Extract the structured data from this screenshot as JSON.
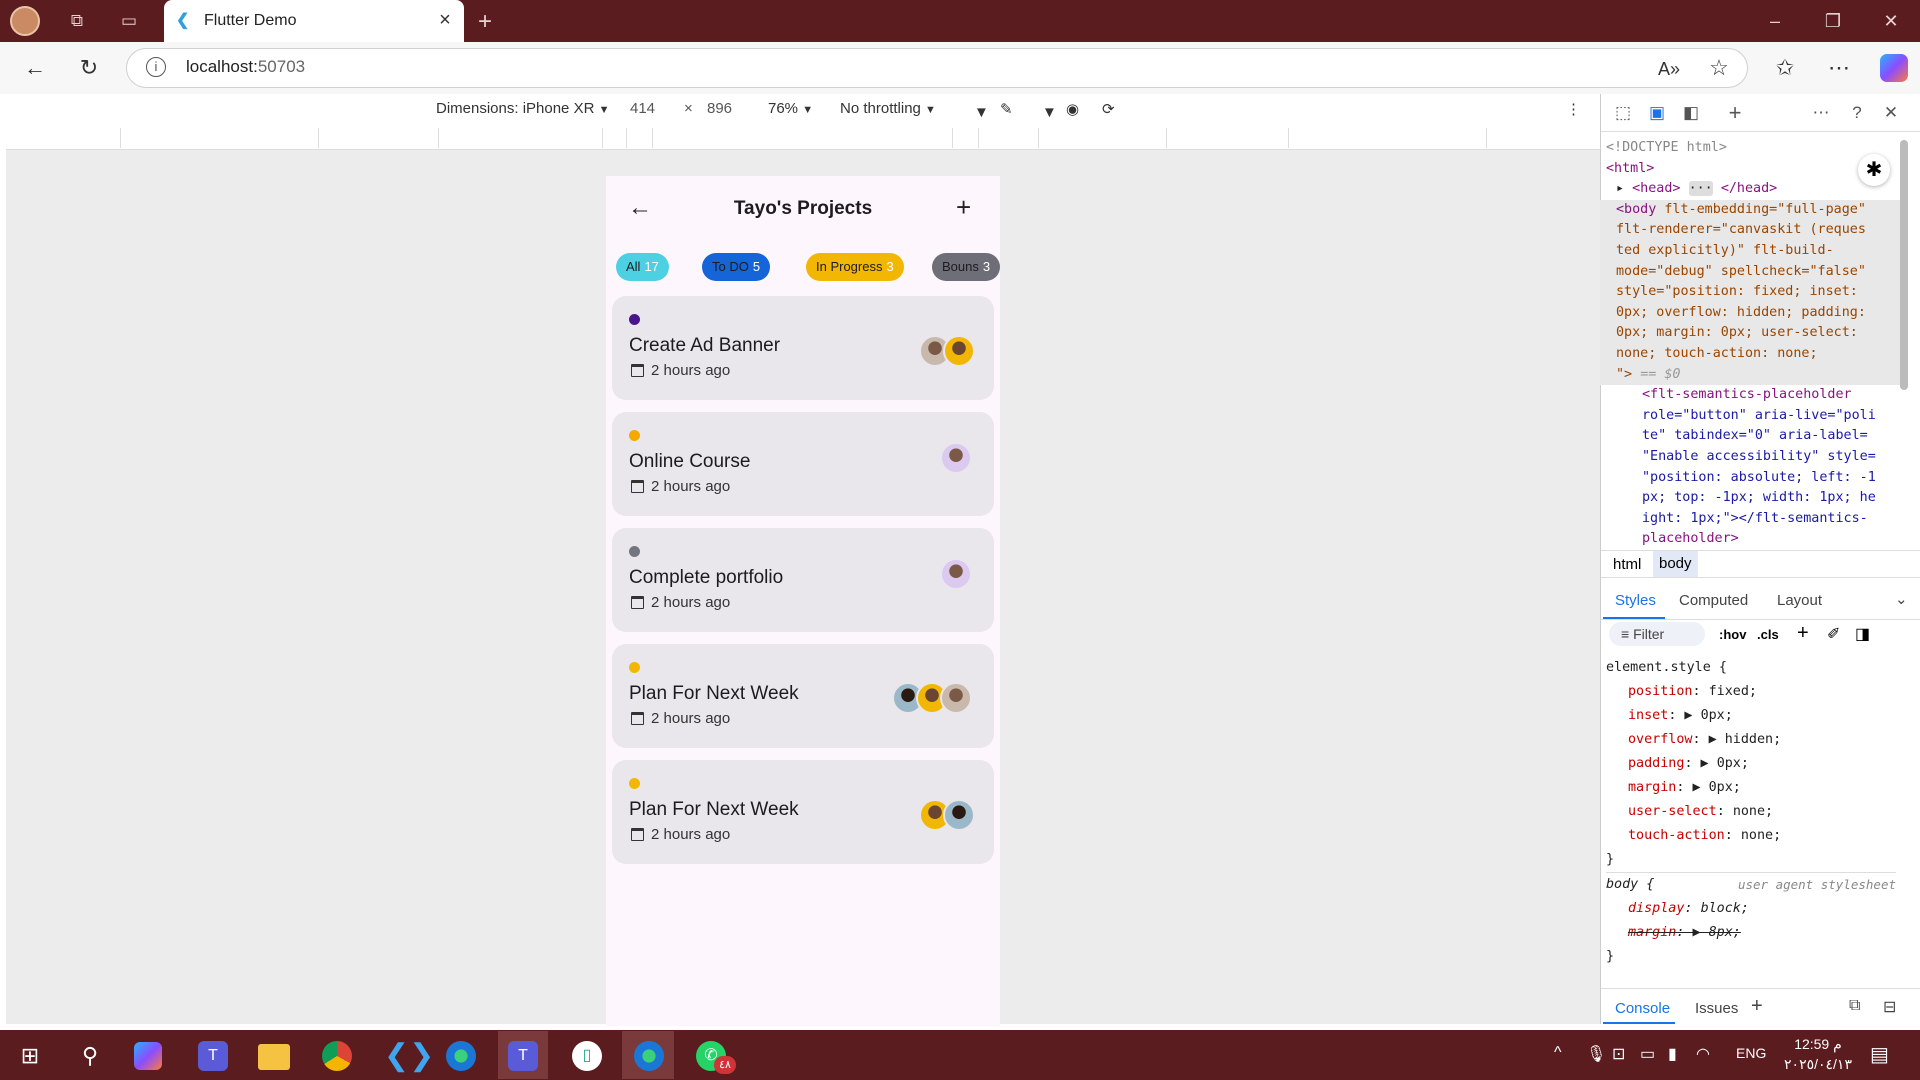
{
  "browser": {
    "tab_title": "Flutter Demo",
    "url_host": "localhost:",
    "url_port": "50703"
  },
  "device_toolbar": {
    "dimensions_label": "Dimensions: iPhone XR",
    "width": "414",
    "times": "×",
    "height": "896",
    "zoom": "76%",
    "throttling": "No throttling"
  },
  "app": {
    "title": "Tayo's Projects",
    "chips": [
      {
        "label": "All",
        "count": "17",
        "bg": "#4dd0e1",
        "fg": "#1d1b20",
        "count_fg": "#ffffff"
      },
      {
        "label": "To DO",
        "count": "5",
        "bg": "#1565d8",
        "fg": "#1d1b20",
        "count_fg": "#ffffff"
      },
      {
        "label": "In Progress",
        "count": "3",
        "bg": "#f2b705",
        "fg": "#1d1b20",
        "count_fg": "#ffffff"
      },
      {
        "label": "Bouns",
        "count": "3",
        "bg": "#6e6e78",
        "fg": "#1d1b20",
        "count_fg": "#ffffff"
      }
    ],
    "tasks": [
      {
        "title": "Create Ad Banner",
        "time": "2 hours ago",
        "dot": "#4a148c",
        "avatars": 2
      },
      {
        "title": "Online Course",
        "time": "2 hours ago",
        "dot": "#f2a900",
        "avatars": 1
      },
      {
        "title": "Complete portfolio",
        "time": "2 hours ago",
        "dot": "#75757f",
        "avatars": 1
      },
      {
        "title": "Plan For Next Week",
        "time": "2 hours ago",
        "dot": "#f2b705",
        "avatars": 3
      },
      {
        "title": "Plan For Next Week",
        "time": "2 hours ago",
        "dot": "#f2b705",
        "avatars": 2
      }
    ]
  },
  "devtools": {
    "code": {
      "doctype": "<!DOCTYPE html>",
      "html_open": "<html>",
      "head": "<head>",
      "head_ellipsis": "···",
      "head_close": "</head>",
      "body_open": "<body",
      "attr1": "flt-embedding=\"full-page\"",
      "attr2": "flt-renderer=\"canvaskit (reques",
      "attr2b": "ted explicitly)\" flt-build-",
      "attr3": "mode=\"debug\" spellcheck=\"false\"",
      "attr4": "style=\"position: fixed; inset:",
      "attr5": "0px; overflow: hidden; padding:",
      "attr6": "0px; margin: 0px; user-select:",
      "attr7": "none; touch-action: none;",
      "attr8": "\">",
      "eq0": "== $0",
      "sem1": "<flt-semantics-placeholder",
      "sem2": "role=\"button\" aria-live=\"poli",
      "sem3": "te\" tabindex=\"0\" aria-label=",
      "sem4": "\"Enable accessibility\" style=",
      "sem5": "\"position: absolute; left: -1",
      "sem6": "px; top: -1px; width: 1px; he",
      "sem7": "ight: 1px;\"></flt-semantics-",
      "sem8": "placeholder>"
    },
    "crumbs": [
      "html",
      "body"
    ],
    "style_tabs": [
      "Styles",
      "Computed",
      "Layout"
    ],
    "filter_placeholder": "Filter",
    "hov": ":hov",
    "cls": ".cls",
    "css": {
      "selector1": "element.style {",
      "rules": [
        {
          "p": "position",
          "v": "fixed;"
        },
        {
          "p": "inset",
          "v": "0px;"
        },
        {
          "p": "overflow",
          "v": "hidden;"
        },
        {
          "p": "padding",
          "v": "0px;"
        },
        {
          "p": "margin",
          "v": "0px;"
        },
        {
          "p": "user-select",
          "v": "none;"
        },
        {
          "p": "touch-action",
          "v": "none;"
        }
      ],
      "close": "}",
      "selector2": "body {",
      "ua": "user agent stylesheet",
      "display_p": "display",
      "display_v": "block;",
      "margin_p": "margin",
      "margin_v": "8px;"
    },
    "bottom_tabs": [
      "Console",
      "Issues"
    ]
  },
  "taskbar": {
    "time": "12:59 م",
    "date": "٢٠٢٥/٠٤/١٣",
    "lang": "ENG",
    "whatsapp_badge": "٤٨"
  }
}
